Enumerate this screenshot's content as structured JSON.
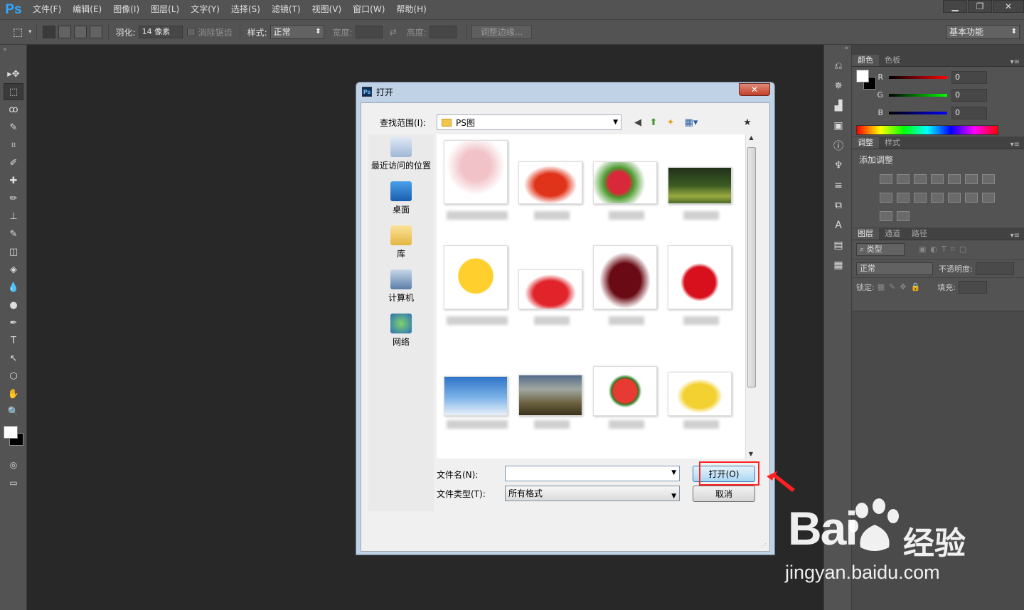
{
  "app": {
    "logo": "Ps"
  },
  "menu": [
    "文件(F)",
    "编辑(E)",
    "图像(I)",
    "图层(L)",
    "文字(Y)",
    "选择(S)",
    "滤镜(T)",
    "视图(V)",
    "窗口(W)",
    "帮助(H)"
  ],
  "window_controls": {
    "minimize": "▁",
    "restore": "❐",
    "close": "✕"
  },
  "options": {
    "feather_label": "羽化:",
    "feather_value": "14 像素",
    "antialias_label": "消除锯齿",
    "style_label": "样式:",
    "style_value": "正常",
    "width_label": "宽度:",
    "height_label": "高度:",
    "refine_edge": "调整边缘...",
    "workspace": "基本功能"
  },
  "tools": [
    "move-icon",
    "marquee-icon",
    "lasso-icon",
    "quick-select-icon",
    "crop-icon",
    "eyedropper-icon",
    "healing-icon",
    "brush-icon",
    "stamp-icon",
    "history-brush-icon",
    "eraser-icon",
    "bucket-icon",
    "blur-icon",
    "dodge-icon",
    "pen-icon",
    "type-icon",
    "path-select-icon",
    "shape-icon",
    "hand-icon",
    "zoom-icon"
  ],
  "tool_glyphs": [
    "▸✥",
    "⬚",
    "ꝏ",
    "✎",
    "⌗",
    "✐",
    "✚",
    "✏",
    "⊥",
    "✎",
    "◫",
    "◈",
    "💧",
    "●",
    "✒",
    "T",
    "↖",
    "⬡",
    "✋",
    "🔍"
  ],
  "color_panel": {
    "tabs": [
      "颜色",
      "色板"
    ],
    "channels": [
      {
        "name": "R",
        "value": "0",
        "color": "#ff0000"
      },
      {
        "name": "G",
        "value": "0",
        "color": "#00ff00"
      },
      {
        "name": "B",
        "value": "0",
        "color": "#0000ff"
      }
    ]
  },
  "adjust_panel": {
    "tabs": [
      "调整",
      "样式"
    ],
    "title": "添加调整"
  },
  "layers_panel": {
    "tabs": [
      "图层",
      "通道",
      "路径"
    ],
    "filter_kind": "类型",
    "blend_mode": "正常",
    "opacity_label": "不透明度:",
    "lock_label": "锁定:",
    "fill_label": "填充:"
  },
  "dialog": {
    "title": "打开",
    "look_in_label": "查找范围(I):",
    "look_in_value": "PS图",
    "places": [
      {
        "name": "recent",
        "label": "最近访问的位置",
        "icon": "recent-places-icon"
      },
      {
        "name": "desktop",
        "label": "桌面",
        "icon": "desktop-icon"
      },
      {
        "name": "library",
        "label": "库",
        "icon": "library-icon"
      },
      {
        "name": "computer",
        "label": "计算机",
        "icon": "computer-icon"
      },
      {
        "name": "network",
        "label": "网络",
        "icon": "network-icon"
      }
    ],
    "files": [
      "hands-image",
      "lobster-image",
      "lychee-image",
      "forest-image",
      "emoji-image",
      "strawberry-image",
      "cherry-image",
      "apple-image",
      "sky-image",
      "sheep-image",
      "watermelon-image",
      "banana-image"
    ],
    "filename_label": "文件名(N):",
    "filename_value": "",
    "filetype_label": "文件类型(T):",
    "filetype_value": "所有格式",
    "open_button": "打开(O)",
    "cancel_button": "取消"
  },
  "watermark": {
    "brand": "Bai",
    "brand2": "经验",
    "url": "jingyan.baidu.com"
  },
  "colors": {
    "highlight": "#ff2020",
    "ps_blue": "#31a8ff",
    "panel_bg": "#535353",
    "canvas_bg": "#282828"
  }
}
